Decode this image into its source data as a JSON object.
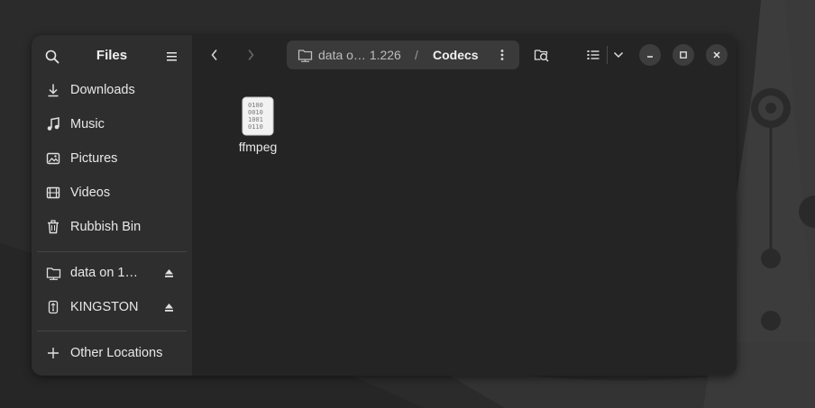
{
  "sidebar": {
    "title": "Files",
    "places": [
      {
        "label": "Downloads",
        "icon": "download-icon"
      },
      {
        "label": "Music",
        "icon": "music-icon"
      },
      {
        "label": "Pictures",
        "icon": "pictures-icon"
      },
      {
        "label": "Videos",
        "icon": "videos-icon"
      },
      {
        "label": "Rubbish Bin",
        "icon": "trash-icon"
      }
    ],
    "devices": [
      {
        "label": "data on 1…",
        "icon": "network-folder-icon"
      },
      {
        "label": "KINGSTON",
        "icon": "usb-drive-icon"
      }
    ],
    "other_locations": "Other Locations"
  },
  "pathbar": {
    "parent": "data o… 1.226",
    "separator": "/",
    "current": "Codecs"
  },
  "files": [
    {
      "name": "ffmpeg",
      "icon": "binary-file-icon",
      "glyph": "0100\n0010\n1001\n0110"
    }
  ],
  "colors": {
    "window_bg": "#242424",
    "sidebar_bg": "#2e2e2e",
    "pathbar_bg": "#3a3a3a",
    "text": "#e8e8e8"
  }
}
